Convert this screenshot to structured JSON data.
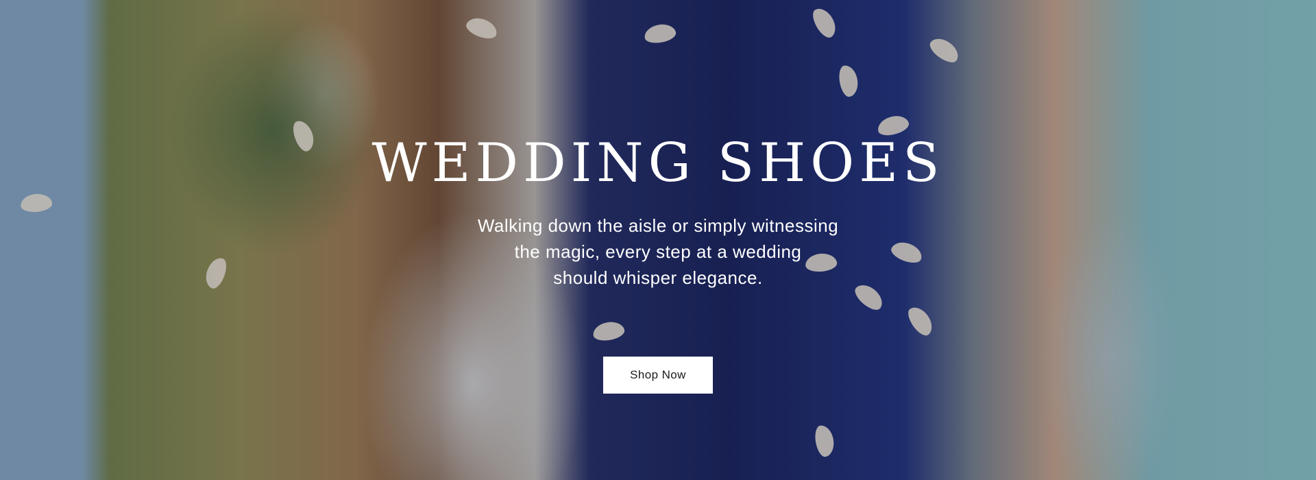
{
  "hero": {
    "title": "WEDDING SHOES",
    "text_lines": [
      "Walking down the aisle or simply witnessing",
      "the magic, every step at a wedding",
      "should whisper elegance."
    ],
    "button_label": "Shop Now",
    "background_image": "wedding-ceremony-photo",
    "colors": {
      "text": "#ffffff",
      "button_bg": "#ffffff",
      "button_text": "#1a1a1a"
    }
  }
}
